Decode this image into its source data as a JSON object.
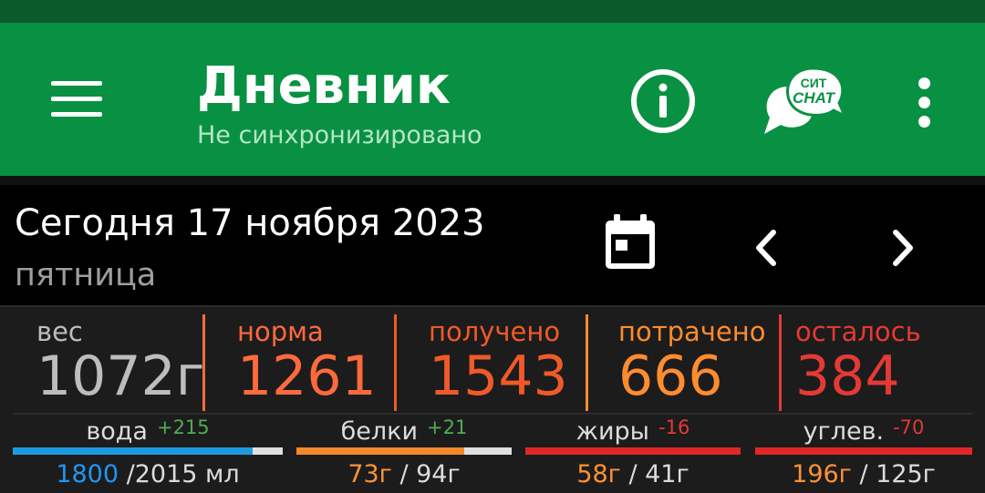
{
  "header": {
    "title": "Дневник",
    "subtitle": "Не синхронизировано",
    "chat_logo_top": "СИТ",
    "chat_logo_bottom": "CHAT"
  },
  "date": {
    "main": "Сегодня 17 ноября 2023",
    "weekday": "пятница"
  },
  "stats": [
    {
      "label": "вес",
      "value": "1072г",
      "label_color": "#bdbdbd",
      "value_color": "#bdbdbd"
    },
    {
      "label": "норма",
      "value": "1261",
      "label_color": "#ff6a3d",
      "value_color": "#ff6a3d"
    },
    {
      "label": "получено",
      "value": "1543",
      "label_color": "#f05a28",
      "value_color": "#f05a28"
    },
    {
      "label": "потрачено",
      "value": "666",
      "label_color": "#ff8c2e",
      "value_color": "#ff8c2e"
    },
    {
      "label": "осталось",
      "value": "384",
      "label_color": "#e53935",
      "value_color": "#e53935"
    }
  ],
  "macros": [
    {
      "name": "вода",
      "delta": "+215",
      "delta_color": "#4caf50",
      "amount": "1800",
      "total": " /2015 мл",
      "amount_color": "#2196f3",
      "bar_color": "#1e9be0",
      "fill": 0.89
    },
    {
      "name": "белки",
      "delta": "+21",
      "delta_color": "#4caf50",
      "amount": "73г",
      "total": " / 94г",
      "amount_color": "#ff9234",
      "bar_color": "#f08a2a",
      "fill": 0.78
    },
    {
      "name": "жиры",
      "delta": "-16",
      "delta_color": "#e53935",
      "amount": "58г",
      "total": " / 41г",
      "amount_color": "#ff9234",
      "bar_color": "#e02828",
      "fill": 1.0
    },
    {
      "name": "углев.",
      "delta": "-70",
      "delta_color": "#e53935",
      "amount": "196г",
      "total": " / 125г",
      "amount_color": "#ff9234",
      "bar_color": "#e02828",
      "fill": 1.0
    }
  ]
}
